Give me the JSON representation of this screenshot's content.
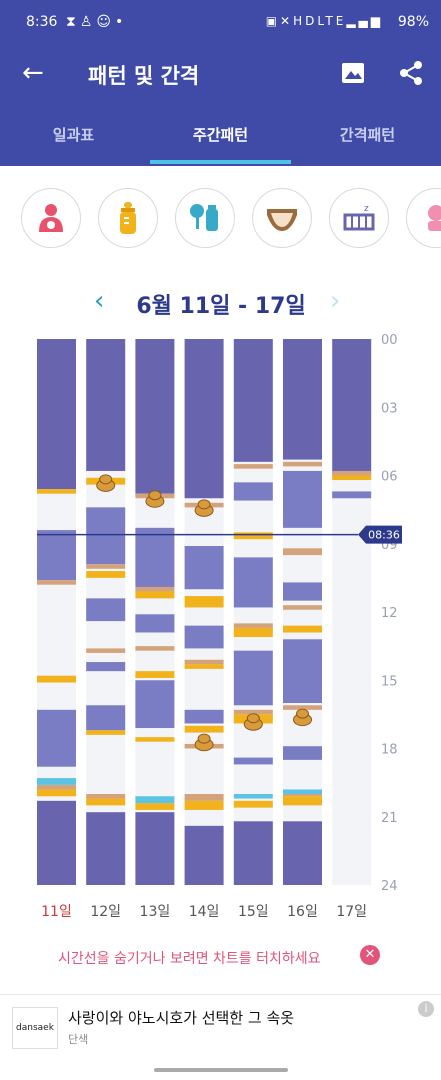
{
  "status_bar": {
    "time": "8:36",
    "left_icons": [
      "hourglass-icon",
      "person-icon",
      "baby-face-icon",
      "dot-icon"
    ],
    "right_icons": [
      "nfc-icon",
      "mute-icon",
      "hd-icon",
      "lte-icon",
      "signal-icon"
    ],
    "battery": "98%"
  },
  "app_bar": {
    "title": "패턴 및 간격"
  },
  "tabs": [
    {
      "label": "일과표",
      "active": false
    },
    {
      "label": "주간패턴",
      "active": true
    },
    {
      "label": "간격패턴",
      "active": false
    }
  ],
  "category_icons": [
    "breastfeeding-icon",
    "bottle-icon",
    "pumping-icon",
    "diaper-icon",
    "sleep-crib-icon",
    "extra-category-icon"
  ],
  "week": {
    "range": "6월 11일 - 17일"
  },
  "colors": {
    "sleep": "#7a7cc4",
    "sleep_dark": "#6864ad",
    "background": "#f2f4f8",
    "feed": "#f1b21c",
    "feed_accent": "#d4a37b",
    "diaper": "#5bc3e3",
    "poop": "#d99a3b",
    "current_time_line": "#2d3a8c",
    "accent": "#3f4ba6"
  },
  "chart_data": {
    "type": "timeline",
    "current_time": "08:36",
    "current_time_hour": 8.6,
    "y_ticks": [
      "00",
      "03",
      "06",
      "09",
      "12",
      "15",
      "18",
      "21",
      "24"
    ],
    "days": [
      {
        "label": "11일",
        "highlight": true,
        "sleep": [
          [
            0,
            6.6
          ],
          [
            8.4,
            10.6
          ],
          [
            16.3,
            18.8
          ],
          [
            20.3,
            24
          ]
        ],
        "feeds": [
          [
            6.6,
            6.8
          ],
          [
            14.8,
            15.1
          ],
          [
            19.8,
            20.1
          ]
        ],
        "accents": [
          [
            10.6,
            10.8
          ],
          [
            19.6,
            19.8
          ]
        ],
        "diapers": [
          [
            19.3,
            19.6
          ]
        ],
        "poops": []
      },
      {
        "label": "12일",
        "highlight": false,
        "sleep": [
          [
            0,
            5.8
          ],
          [
            7.4,
            9.9
          ],
          [
            11.4,
            12.4
          ],
          [
            14.2,
            14.6
          ],
          [
            16.1,
            17.2
          ],
          [
            20.8,
            24
          ]
        ],
        "feeds": [
          [
            6.1,
            6.4
          ],
          [
            10.2,
            10.5
          ],
          [
            17.2,
            17.4
          ],
          [
            20.2,
            20.5
          ]
        ],
        "accents": [
          [
            9.9,
            10.1
          ],
          [
            13.6,
            13.8
          ],
          [
            20.0,
            20.2
          ]
        ],
        "diapers": [],
        "poops": [
          6.3
        ]
      },
      {
        "label": "13일",
        "highlight": false,
        "sleep": [
          [
            0,
            6.8
          ],
          [
            8.3,
            10.9
          ],
          [
            12.1,
            12.9
          ],
          [
            15.0,
            17.1
          ],
          [
            20.8,
            24
          ]
        ],
        "feeds": [
          [
            11.1,
            11.4
          ],
          [
            14.6,
            14.9
          ],
          [
            17.5,
            17.7
          ],
          [
            20.4,
            20.7
          ]
        ],
        "accents": [
          [
            6.8,
            7.0
          ],
          [
            10.9,
            11.1
          ],
          [
            13.5,
            13.7
          ]
        ],
        "diapers": [
          [
            20.1,
            20.4
          ]
        ],
        "poops": [
          7.0
        ]
      },
      {
        "label": "14일",
        "highlight": false,
        "sleep": [
          [
            0,
            7.0
          ],
          [
            9.1,
            11.0
          ],
          [
            12.6,
            13.6
          ],
          [
            16.3,
            16.9
          ],
          [
            21.4,
            24
          ]
        ],
        "feeds": [
          [
            11.3,
            11.8
          ],
          [
            14.3,
            14.5
          ],
          [
            17.0,
            17.3
          ],
          [
            20.3,
            20.7
          ]
        ],
        "accents": [
          [
            7.2,
            7.4
          ],
          [
            14.1,
            14.3
          ],
          [
            17.8,
            18.0
          ],
          [
            20.0,
            20.3
          ]
        ],
        "diapers": [],
        "poops": [
          7.4,
          17.7
        ]
      },
      {
        "label": "15일",
        "highlight": false,
        "sleep": [
          [
            0,
            5.4
          ],
          [
            6.3,
            7.1
          ],
          [
            9.6,
            11.8
          ],
          [
            13.7,
            16.1
          ],
          [
            18.4,
            18.7
          ],
          [
            21.2,
            24
          ]
        ],
        "feeds": [
          [
            8.5,
            8.8
          ],
          [
            12.7,
            13.1
          ],
          [
            16.5,
            16.9
          ],
          [
            20.3,
            20.6
          ]
        ],
        "accents": [
          [
            5.5,
            5.7
          ],
          [
            12.5,
            12.7
          ],
          [
            16.3,
            16.5
          ]
        ],
        "diapers": [
          [
            20.0,
            20.2
          ]
        ],
        "poops": [
          16.8
        ]
      },
      {
        "label": "16일",
        "highlight": false,
        "sleep": [
          [
            0,
            5.3
          ],
          [
            5.8,
            8.3
          ],
          [
            10.7,
            11.5
          ],
          [
            13.2,
            16.0
          ],
          [
            17.9,
            18.5
          ],
          [
            21.2,
            24
          ]
        ],
        "feeds": [
          [
            12.6,
            12.9
          ],
          [
            20.1,
            20.5
          ]
        ],
        "accents": [
          [
            5.4,
            5.6
          ],
          [
            9.2,
            9.5
          ],
          [
            11.7,
            11.9
          ],
          [
            16.1,
            16.3
          ],
          [
            19.9,
            20.1
          ]
        ],
        "diapers": [
          [
            19.8,
            20.0
          ]
        ],
        "poops": [
          16.6
        ]
      },
      {
        "label": "17일",
        "highlight": false,
        "sleep": [
          [
            0,
            5.9
          ],
          [
            6.7,
            7.0
          ]
        ],
        "feeds": [
          [
            6.0,
            6.2
          ]
        ],
        "accents": [
          [
            5.8,
            6.0
          ]
        ],
        "diapers": [],
        "poops": []
      }
    ]
  },
  "hint": {
    "text": "시간선을 숨기거나 보려면 차트를 터치하세요"
  },
  "ad": {
    "logo_text": "dansaek",
    "title": "사랑이와 야노시호가 선택한 그 속옷",
    "subtitle": "단색"
  }
}
